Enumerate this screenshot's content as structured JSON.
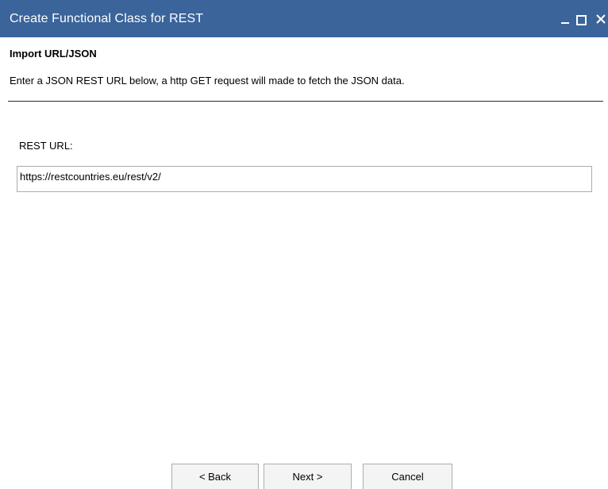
{
  "window": {
    "title": "Create Functional Class for REST",
    "titlebar_color": "#3a649a",
    "controls": [
      "minimize-icon",
      "maximize-icon",
      "close-icon"
    ]
  },
  "header": {
    "title": "Import URL/JSON",
    "description": "Enter a JSON REST URL below, a http GET request will made to fetch the JSON data."
  },
  "form": {
    "url_label": "REST URL:",
    "url_value": "https://restcountries.eu/rest/v2/"
  },
  "buttons": {
    "back": "< Back",
    "next": "Next >",
    "cancel": "Cancel"
  }
}
